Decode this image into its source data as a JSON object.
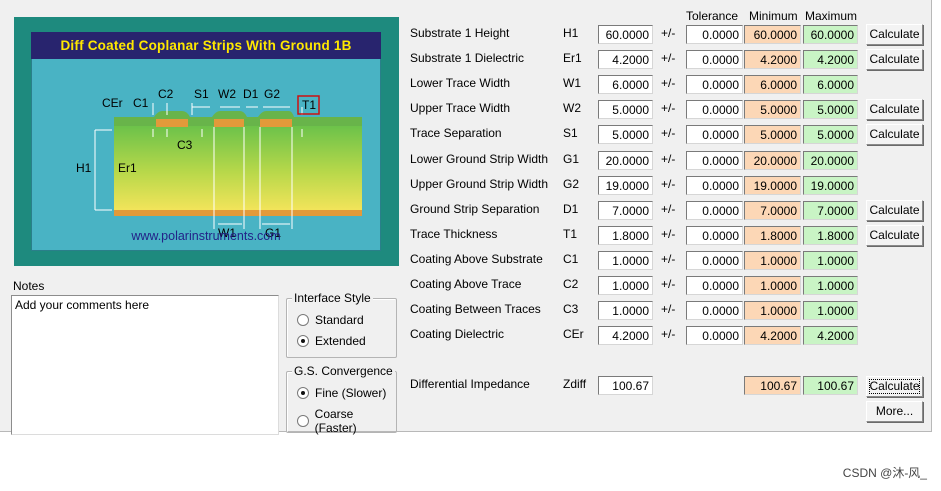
{
  "diagram": {
    "title": "Diff Coated Coplanar Strips With Ground  1B",
    "url": "www.polarinstruments.com",
    "labels": {
      "cer": "CEr",
      "c1": "C1",
      "c2": "C2",
      "s1": "S1",
      "w2": "W2",
      "d1": "D1",
      "g2": "G2",
      "t1": "T1",
      "c3": "C3",
      "h1": "H1",
      "er1": "Er1",
      "w1": "W1",
      "g1": "G1"
    }
  },
  "headers": {
    "tolerance": "Tolerance",
    "minimum": "Minimum",
    "maximum": "Maximum"
  },
  "params": [
    {
      "label": "Substrate 1 Height",
      "symbol": "H1",
      "value": "60.0000",
      "tol": "0.0000",
      "min": "60.0000",
      "max": "60.0000",
      "button": "Calculate"
    },
    {
      "label": "Substrate 1 Dielectric",
      "symbol": "Er1",
      "value": "4.2000",
      "tol": "0.0000",
      "min": "4.2000",
      "max": "4.2000",
      "button": "Calculate"
    },
    {
      "label": "Lower Trace Width",
      "symbol": "W1",
      "value": "6.0000",
      "tol": "0.0000",
      "min": "6.0000",
      "max": "6.0000",
      "button": ""
    },
    {
      "label": "Upper Trace Width",
      "symbol": "W2",
      "value": "5.0000",
      "tol": "0.0000",
      "min": "5.0000",
      "max": "5.0000",
      "button": "Calculate"
    },
    {
      "label": "Trace Separation",
      "symbol": "S1",
      "value": "5.0000",
      "tol": "0.0000",
      "min": "5.0000",
      "max": "5.0000",
      "button": "Calculate"
    },
    {
      "label": "Lower Ground Strip Width",
      "symbol": "G1",
      "value": "20.0000",
      "tol": "0.0000",
      "min": "20.0000",
      "max": "20.0000",
      "button": ""
    },
    {
      "label": "Upper Ground Strip Width",
      "symbol": "G2",
      "value": "19.0000",
      "tol": "0.0000",
      "min": "19.0000",
      "max": "19.0000",
      "button": ""
    },
    {
      "label": "Ground Strip Separation",
      "symbol": "D1",
      "value": "7.0000",
      "tol": "0.0000",
      "min": "7.0000",
      "max": "7.0000",
      "button": "Calculate"
    },
    {
      "label": "Trace Thickness",
      "symbol": "T1",
      "value": "1.8000",
      "tol": "0.0000",
      "min": "1.8000",
      "max": "1.8000",
      "button": "Calculate"
    },
    {
      "label": "Coating Above Substrate",
      "symbol": "C1",
      "value": "1.0000",
      "tol": "0.0000",
      "min": "1.0000",
      "max": "1.0000",
      "button": ""
    },
    {
      "label": "Coating Above Trace",
      "symbol": "C2",
      "value": "1.0000",
      "tol": "0.0000",
      "min": "1.0000",
      "max": "1.0000",
      "button": ""
    },
    {
      "label": "Coating Between Traces",
      "symbol": "C3",
      "value": "1.0000",
      "tol": "0.0000",
      "min": "1.0000",
      "max": "1.0000",
      "button": ""
    },
    {
      "label": "Coating Dielectric",
      "symbol": "CEr",
      "value": "4.2000",
      "tol": "0.0000",
      "min": "4.2000",
      "max": "4.2000",
      "button": ""
    }
  ],
  "pm_sign": "+/-",
  "impedance": {
    "label": "Differential Impedance",
    "symbol": "Zdiff",
    "value": "100.67",
    "min": "100.67",
    "max": "100.67",
    "button": "Calculate",
    "more": "More..."
  },
  "notes": {
    "label": "Notes",
    "text": "Add your comments here"
  },
  "interface_style": {
    "legend": "Interface Style",
    "options": [
      "Standard",
      "Extended"
    ],
    "selected": "Extended"
  },
  "convergence": {
    "legend": "G.S. Convergence",
    "options": [
      "Fine (Slower)",
      "Coarse (Faster)"
    ],
    "selected": "Fine (Slower)"
  },
  "watermark": "CSDN @沐-风_",
  "colors": {
    "min_fill": "#fcd7b6",
    "max_fill": "#c9f4c5",
    "title_text": "#ffe800",
    "title_bg": "#28246e",
    "frame": "#1e8a7e"
  }
}
